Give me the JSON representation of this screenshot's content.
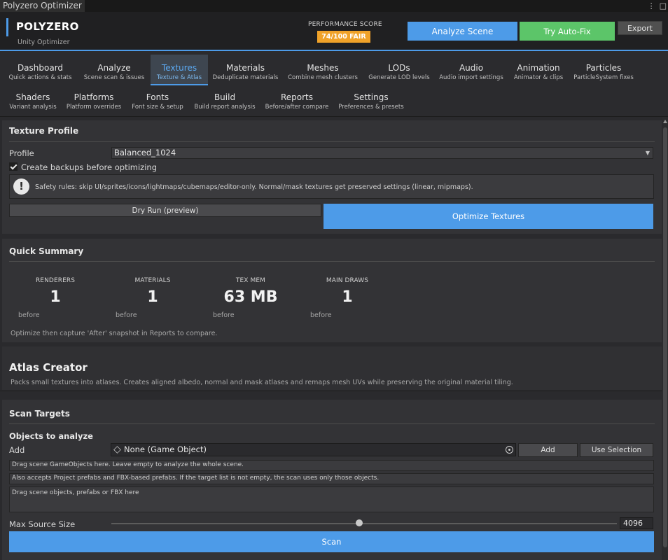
{
  "window": {
    "title": "Polyzero Optimizer",
    "menu_icon": "kebab-menu-icon",
    "maximize_icon": "maximize-icon"
  },
  "header": {
    "brand": "POLYZERO",
    "subtitle": "Unity Optimizer",
    "perf_label": "PERFORMANCE SCORE",
    "perf_value": "74/100 FAIR",
    "analyze_label": "Analyze Scene",
    "autofix_label": "Try Auto-Fix",
    "export_label": "Export",
    "colors": {
      "accent": "#4d9be8",
      "autofix": "#5cc569",
      "badge": "#f0a229"
    }
  },
  "tabs": [
    {
      "label": "Dashboard",
      "sub": "Quick actions & stats"
    },
    {
      "label": "Analyze",
      "sub": "Scene scan & issues"
    },
    {
      "label": "Textures",
      "sub": "Texture & Atlas"
    },
    {
      "label": "Materials",
      "sub": "Deduplicate materials"
    },
    {
      "label": "Meshes",
      "sub": "Combine mesh clusters"
    },
    {
      "label": "LODs",
      "sub": "Generate LOD levels"
    },
    {
      "label": "Audio",
      "sub": "Audio import settings"
    },
    {
      "label": "Animation",
      "sub": "Animator & clips"
    },
    {
      "label": "Particles",
      "sub": "ParticleSystem fixes"
    },
    {
      "label": "Shaders",
      "sub": "Variant analysis"
    },
    {
      "label": "Platforms",
      "sub": "Platform overrides"
    },
    {
      "label": "Fonts",
      "sub": "Font size & setup"
    },
    {
      "label": "Build",
      "sub": "Build report analysis"
    },
    {
      "label": "Reports",
      "sub": "Before/after compare"
    },
    {
      "label": "Settings",
      "sub": "Preferences & presets"
    }
  ],
  "active_tab": "Textures",
  "texture_profile": {
    "title": "Texture Profile",
    "profile_label": "Profile",
    "profile_value": "Balanced_1024",
    "backup_label": "Create backups before optimizing",
    "backup_checked": true,
    "safety_text": "Safety rules: skip UI/sprites/icons/lightmaps/cubemaps/editor-only. Normal/mask textures get preserved settings (linear, mipmaps).",
    "safety_icon": "warning-icon",
    "dry_run_label": "Dry Run (preview)",
    "optimize_label": "Optimize Textures"
  },
  "quick_summary": {
    "title": "Quick Summary",
    "stats": [
      {
        "label": "RENDERERS",
        "value": "1",
        "sub": "before"
      },
      {
        "label": "MATERIALS",
        "value": "1",
        "sub": "before"
      },
      {
        "label": "TEX MEM",
        "value": "63 MB",
        "sub": "before"
      },
      {
        "label": "MAIN DRAWS",
        "value": "1",
        "sub": "before"
      }
    ],
    "note": "Optimize then capture 'After' snapshot in Reports to compare."
  },
  "atlas": {
    "title": "Atlas Creator",
    "description": "Packs small textures into atlases. Creates aligned albedo, normal and mask atlases and remaps mesh UVs while preserving the original material tiling."
  },
  "scan_targets": {
    "title": "Scan Targets",
    "objects_label": "Objects to analyze",
    "add_label": "Add",
    "object_field_value": "None (Game Object)",
    "add_button": "Add",
    "use_selection_button": "Use Selection",
    "hint1": "Drag scene GameObjects here. Leave empty to analyze the whole scene.",
    "hint2": "Also accepts Project prefabs and FBX-based prefabs. If the target list is not empty, the scan uses only those objects.",
    "drop_hint": "Drag scene objects, prefabs or FBX here",
    "max_source_label": "Max Source Size",
    "max_source_value": "4096",
    "slider_fraction": 0.49,
    "scan_button": "Scan"
  }
}
